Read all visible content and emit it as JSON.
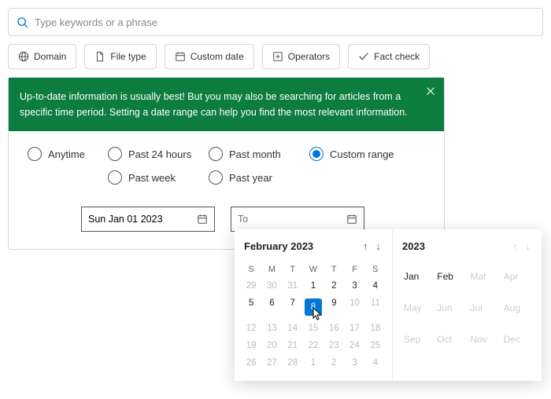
{
  "search": {
    "placeholder": "Type keywords or a phrase"
  },
  "filters": {
    "domain": "Domain",
    "filetype": "File type",
    "customdate": "Custom date",
    "operators": "Operators",
    "factcheck": "Fact check"
  },
  "tip": {
    "text": "Up-to-date information is usually best! But you may also be searching for articles from a specific time period. Setting a date range can help you find the most relevant information."
  },
  "radios": {
    "anytime": "Anytime",
    "past24": "Past 24 hours",
    "pastmonth": "Past month",
    "custom": "Custom range",
    "pastweek": "Past week",
    "pastyear": "Past year"
  },
  "dates": {
    "from": "Sun Jan 01 2023",
    "to_placeholder": "To"
  },
  "calendar": {
    "title": "February 2023",
    "dow": [
      "S",
      "M",
      "T",
      "W",
      "T",
      "F",
      "S"
    ],
    "grid": [
      {
        "n": "29",
        "o": true
      },
      {
        "n": "30",
        "o": true
      },
      {
        "n": "31",
        "o": true
      },
      {
        "n": "1"
      },
      {
        "n": "2"
      },
      {
        "n": "3"
      },
      {
        "n": "4"
      },
      {
        "n": "5"
      },
      {
        "n": "6"
      },
      {
        "n": "7"
      },
      {
        "n": "8",
        "sel": true
      },
      {
        "n": "9"
      },
      {
        "n": "10",
        "o": true
      },
      {
        "n": "11",
        "o": true
      },
      {
        "n": "12",
        "o": true
      },
      {
        "n": "13",
        "o": true
      },
      {
        "n": "14",
        "o": true
      },
      {
        "n": "15",
        "o": true
      },
      {
        "n": "16",
        "o": true
      },
      {
        "n": "17",
        "o": true
      },
      {
        "n": "18",
        "o": true
      },
      {
        "n": "19",
        "o": true
      },
      {
        "n": "20",
        "o": true
      },
      {
        "n": "21",
        "o": true
      },
      {
        "n": "22",
        "o": true
      },
      {
        "n": "23",
        "o": true
      },
      {
        "n": "24",
        "o": true
      },
      {
        "n": "25",
        "o": true
      },
      {
        "n": "26",
        "o": true
      },
      {
        "n": "27",
        "o": true
      },
      {
        "n": "28",
        "o": true
      },
      {
        "n": "1",
        "o": true
      },
      {
        "n": "2",
        "o": true
      },
      {
        "n": "3",
        "o": true
      },
      {
        "n": "4",
        "o": true
      }
    ]
  },
  "yearPanel": {
    "title": "2023",
    "months": [
      {
        "l": "Jan"
      },
      {
        "l": "Feb"
      },
      {
        "l": "Mar",
        "d": true
      },
      {
        "l": "Apr",
        "d": true
      },
      {
        "l": "May",
        "d": true
      },
      {
        "l": "Jun",
        "d": true
      },
      {
        "l": "Jul",
        "d": true
      },
      {
        "l": "Aug",
        "d": true
      },
      {
        "l": "Sep",
        "d": true
      },
      {
        "l": "Oct",
        "d": true
      },
      {
        "l": "Nov",
        "d": true
      },
      {
        "l": "Dec",
        "d": true
      }
    ]
  }
}
